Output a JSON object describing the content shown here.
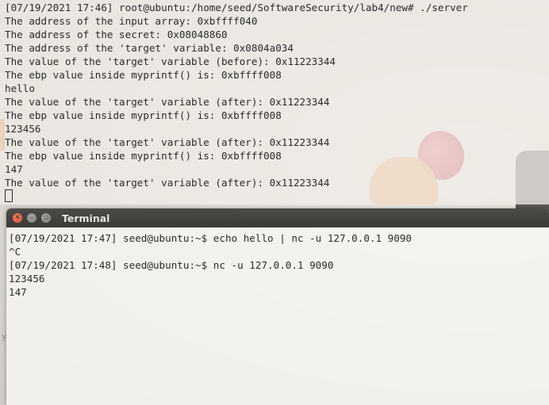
{
  "back_terminal": {
    "lines": [
      "[07/19/2021 17:46] root@ubuntu:/home/seed/SoftwareSecurity/lab4/new# ./server",
      "The address of the input array: 0xbffff040",
      "The address of the secret: 0x08048860",
      "The address of the 'target' variable: 0x0804a034",
      "The value of the 'target' variable (before): 0x11223344",
      "The ebp value inside myprintf() is: 0xbffff008",
      "hello",
      "The value of the 'target' variable (after): 0x11223344",
      "The ebp value inside myprintf() is: 0xbffff008",
      "123456",
      "The value of the 'target' variable (after): 0x11223344",
      "The ebp value inside myprintf() is: 0xbffff008",
      "147",
      "The value of the 'target' variable (after): 0x11223344"
    ]
  },
  "front_terminal": {
    "title": "Terminal",
    "lines": [
      "[07/19/2021 17:47] seed@ubuntu:~$ echo hello | nc -u 127.0.0.1 9090",
      "^C",
      "[07/19/2021 17:48] seed@ubuntu:~$ nc -u 127.0.0.1 9090",
      "123456",
      "147"
    ]
  },
  "desktop": {
    "side_glyph": "y"
  },
  "colors": {
    "terminal_text": "#2b2b2b",
    "titlebar": "#3b3a36",
    "close_button": "#dd4c30"
  },
  "icons": {
    "close": "close-icon",
    "minimize": "minimize-icon",
    "maximize": "maximize-icon",
    "cursor": "block-cursor"
  }
}
